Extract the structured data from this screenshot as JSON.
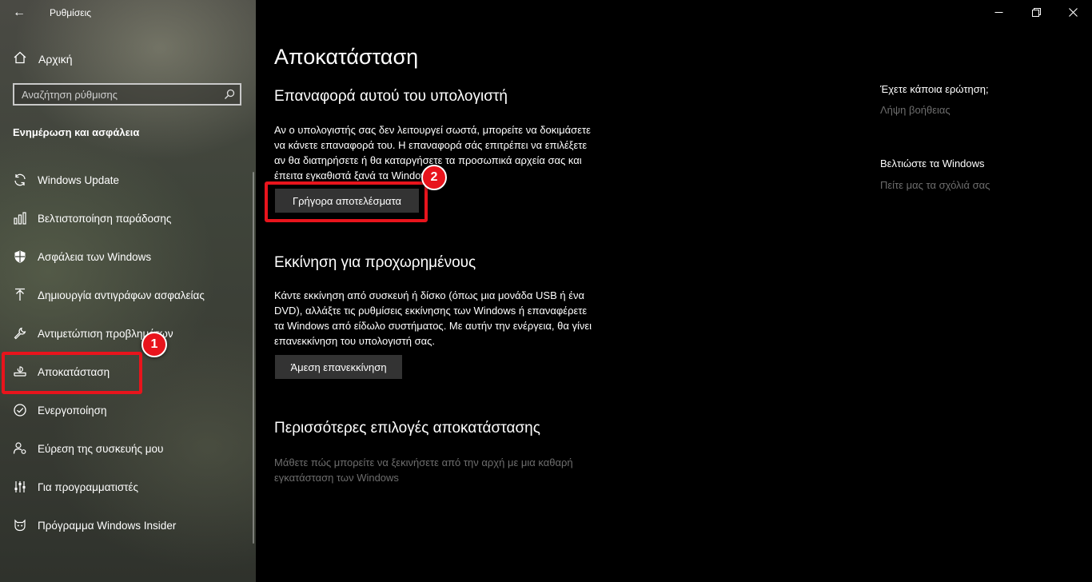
{
  "window": {
    "title": "Ρυθμίσεις",
    "controls": {
      "minimize_icon": "minimize-icon",
      "maximize_icon": "restore-icon",
      "close_icon": "close-icon"
    }
  },
  "sidebar": {
    "home_label": "Αρχική",
    "search_placeholder": "Αναζήτηση ρύθμισης",
    "section_title": "Ενημέρωση και ασφάλεια",
    "items": [
      {
        "label": "Windows Update",
        "icon": "refresh-icon"
      },
      {
        "label": "Βελτιστοποίηση παράδοσης",
        "icon": "delivery-optimization-icon"
      },
      {
        "label": "Ασφάλεια των Windows",
        "icon": "shield-icon"
      },
      {
        "label": "Δημιουργία αντιγράφων ασφαλείας",
        "icon": "upload-arrow-icon"
      },
      {
        "label": "Αντιμετώπιση προβλημάτων",
        "icon": "wrench-icon"
      },
      {
        "label": "Αποκατάσταση",
        "icon": "recovery-icon"
      },
      {
        "label": "Ενεργοποίηση",
        "icon": "check-circle-icon"
      },
      {
        "label": "Εύρεση της συσκευής μου",
        "icon": "person-location-icon"
      },
      {
        "label": "Για προγραμματιστές",
        "icon": "developer-sliders-icon"
      },
      {
        "label": "Πρόγραμμα Windows Insider",
        "icon": "insider-cat-icon"
      }
    ],
    "selected": "Αποκατάσταση"
  },
  "annotations": {
    "badge_1": "1",
    "badge_2": "2"
  },
  "main": {
    "title": "Αποκατάσταση",
    "reset": {
      "heading": "Επαναφορά αυτού του υπολογιστή",
      "lines": [
        "Αν ο υπολογιστής σας δεν λειτουργεί σωστά, μπορείτε να δοκιμάσετε",
        "να κάνετε επαναφορά του. Η επαναφορά σάς επιτρέπει να επιλέξετε",
        "αν θα διατηρήσετε ή θα καταργήσετε τα προσωπικά αρχεία σας και",
        "έπειτα εγκαθιστά ξανά τα Windows."
      ],
      "button": "Γρήγορα αποτελέσματα"
    },
    "advanced": {
      "heading": "Εκκίνηση για προχωρημένους",
      "lines": [
        "Κάντε εκκίνηση από συσκευή ή δίσκο (όπως μια μονάδα USB ή ένα",
        "DVD), αλλάξτε τις ρυθμίσεις εκκίνησης των Windows ή επαναφέρετε",
        "τα Windows από είδωλο συστήματος. Με αυτήν την ενέργεια, θα γίνει",
        "επανεκκίνηση του υπολογιστή σας."
      ],
      "button": "Άμεση επανεκκίνηση"
    },
    "more": {
      "heading": "Περισσότερες επιλογές αποκατάστασης",
      "lines": [
        "Μάθετε πώς μπορείτε να ξεκινήσετε από την αρχή με μια καθαρή",
        "εγκατάσταση των Windows"
      ]
    }
  },
  "right_panel": {
    "question_heading": "Έχετε κάποια ερώτηση;",
    "help_link": "Λήψη βοήθειας",
    "improve_heading": "Βελτιώστε τα Windows",
    "feedback_link": "Πείτε μας τα σχόλιά σας"
  },
  "colors": {
    "highlight": "#e8141c",
    "muted_text": "#6d6d6d",
    "button_bg": "#333333"
  }
}
